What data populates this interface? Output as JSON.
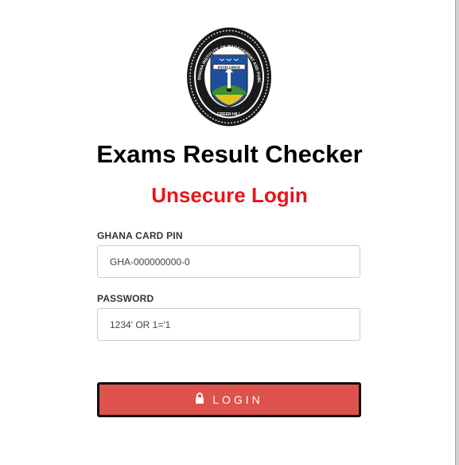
{
  "header": {
    "logo_icon": "institution-crest-icon",
    "logo_ring_top_text": "GHANA INSTITUTE OF MANAGEMENT AND PUBLIC ADMINISTRATION",
    "logo_ribbon_text": "EXCELLENCE",
    "logo_bottom_text": "GREEN HILL",
    "title": "Exams Result Checker",
    "subtitle": "Unsecure Login"
  },
  "form": {
    "pin_label": "GHANA CARD PIN",
    "pin_value": "GHA-000000000-0",
    "password_label": "PASSWORD",
    "password_value": "1234' OR 1='1",
    "login_button_label": "LOGIN",
    "login_icon": "lock-icon"
  },
  "colors": {
    "subtitle_red": "#e8141b",
    "button_red": "#dd524d",
    "button_border": "#0e0e0e"
  }
}
